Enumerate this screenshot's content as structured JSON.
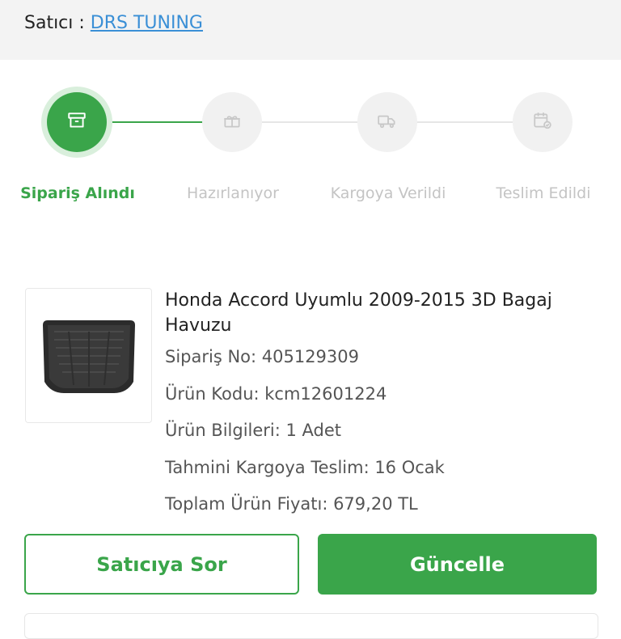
{
  "seller": {
    "prefix": "Satıcı : ",
    "name": "DRS TUNING"
  },
  "tracker": {
    "steps": [
      {
        "label": "Sipariş Alındı",
        "icon": "box-icon",
        "active": true
      },
      {
        "label": "Hazırlanıyor",
        "icon": "gift-box-icon",
        "active": false
      },
      {
        "label": "Kargoya Verildi",
        "icon": "delivery-truck-icon",
        "active": false
      },
      {
        "label": "Teslim Edildi",
        "icon": "delivered-calendar-icon",
        "active": false
      }
    ]
  },
  "product": {
    "title": "Honda Accord Uyumlu 2009-2015 3D Bagaj Havuzu",
    "order_no": "Sipariş No: 405129309",
    "product_code": "Ürün Kodu: kcm12601224",
    "product_info": "Ürün Bilgileri: 1 Adet",
    "estimated_shipping": "Tahmini Kargoya Teslim: 16 Ocak",
    "total_price": "Toplam Ürün Fiyatı: 679,20 TL"
  },
  "actions": {
    "ask_seller": "Satıcıya Sor",
    "update": "Güncelle"
  },
  "colors": {
    "accent": "#3aa54a",
    "link": "#3a8fd6",
    "inactive": "#c4c4c4"
  }
}
